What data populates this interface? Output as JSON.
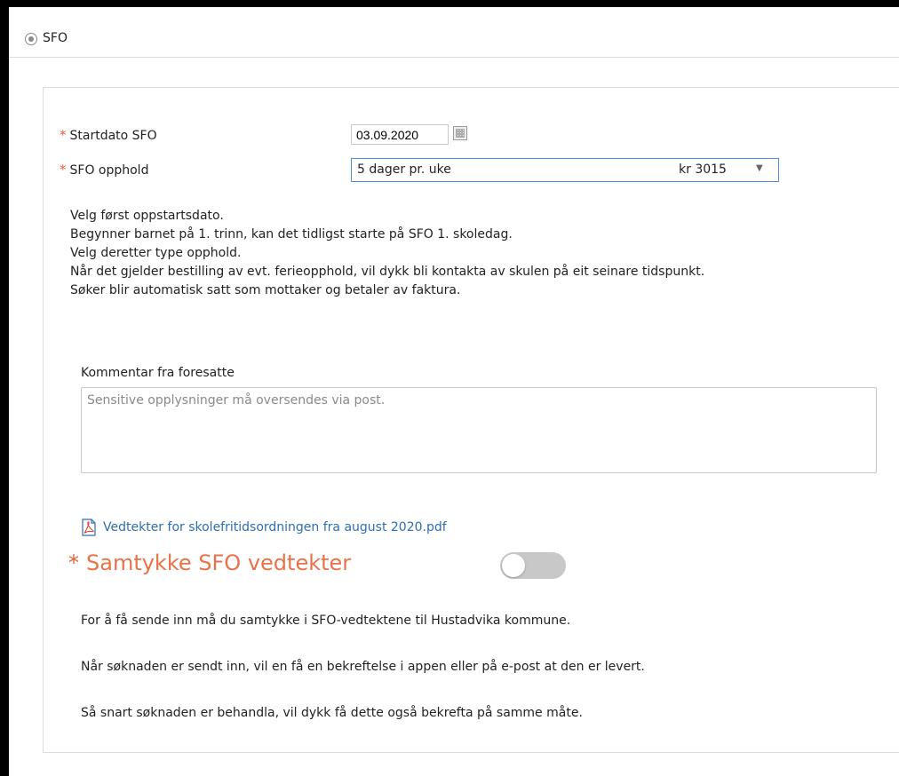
{
  "header": {
    "title": "SFO"
  },
  "form": {
    "startdate": {
      "required_mark": "*",
      "label": "Startdato SFO",
      "value": "03.09.2020"
    },
    "stay": {
      "required_mark": "*",
      "label": "SFO opphold",
      "selected": "5 dager pr. uke",
      "price": "kr 3015"
    },
    "instructions": [
      "Velg først oppstartsdato.",
      "Begynner barnet på 1. trinn, kan det tidligst starte på SFO 1. skoledag.",
      "Velg deretter type opphold.",
      "Når det gjelder bestilling av evt. ferieopphold, vil dykk bli kontakta av skulen på eit seinare tidspunkt.",
      "Søker blir automatisk satt som mottaker og betaler av faktura."
    ],
    "comment": {
      "label": "Kommentar fra foresatte",
      "placeholder": "Sensitive opplysninger må oversendes via post.",
      "value": ""
    },
    "pdf_link": "Vedtekter for skolefritidsordningen fra august 2020.pdf",
    "consent": {
      "required_mark": "*",
      "label": "Samtykke SFO vedtekter",
      "checked": false
    },
    "info": [
      "For å få sende inn må du samtykke i SFO-vedtektene til Hustadvika kommune.",
      "Når søknaden er sendt inn, vil en få en bekreftelse i appen eller på e-post at den er levert.",
      "Så snart søknaden er behandla, vil dykk få dette også bekrefta på samme måte."
    ]
  },
  "colors": {
    "accent_required": "#e8603c",
    "link": "#2f6fb0",
    "select_border": "#4a90d9",
    "toggle_off": "#c8c8c8"
  },
  "icons": {
    "radio": "radio-selected-icon",
    "calendar": "calendar-icon",
    "dropdown": "chevron-down-icon",
    "pdf": "pdf-file-icon"
  }
}
